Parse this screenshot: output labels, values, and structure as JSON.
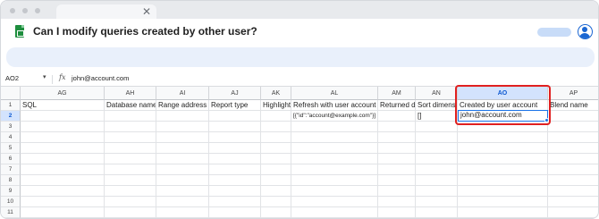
{
  "titlebar": {
    "tab_close": "✕"
  },
  "header": {
    "question": "Can I modify queries created by other user?"
  },
  "formula_bar": {
    "namebox": "AO2",
    "namebox_caret": "▾",
    "fx": "fx",
    "value": "john@account.com"
  },
  "columns": [
    {
      "id": "AG",
      "header": "SQL"
    },
    {
      "id": "AH",
      "header": "Database name"
    },
    {
      "id": "AI",
      "header": "Range address (t"
    },
    {
      "id": "AJ",
      "header": "Report type"
    },
    {
      "id": "AK",
      "header": "Highlight"
    },
    {
      "id": "AL",
      "header": "Refresh with user account"
    },
    {
      "id": "AM",
      "header": "Returned da"
    },
    {
      "id": "AN",
      "header": "Sort dimensi"
    },
    {
      "id": "AO",
      "header": "Created by user account"
    },
    {
      "id": "AP",
      "header": "Blend name"
    }
  ],
  "row2": {
    "AL": "[{\"id\":\"account@example.com\"}]",
    "AN": "[]",
    "AO": "john@account.com"
  },
  "row_numbers": [
    "1",
    "2",
    "3",
    "4",
    "5",
    "6",
    "7",
    "8",
    "9",
    "10",
    "11"
  ],
  "selected": {
    "column": "AO",
    "row": "2"
  },
  "colors": {
    "accent": "#1a73e8",
    "highlight": "#e02020",
    "sheets_green": "#1e8e3e"
  }
}
